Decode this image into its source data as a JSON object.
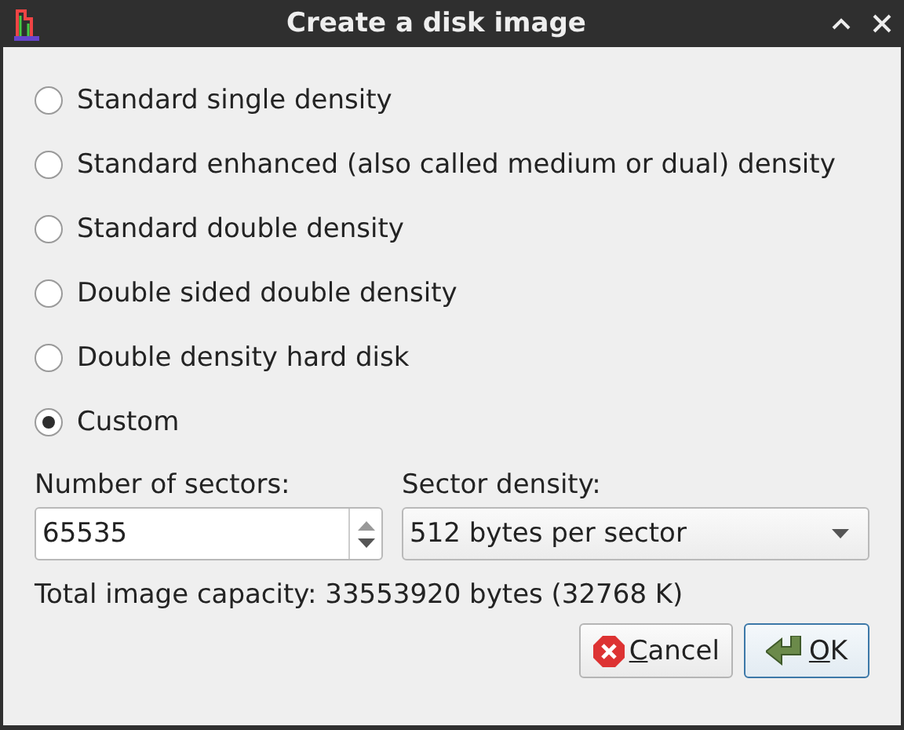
{
  "window": {
    "title": "Create a disk image"
  },
  "density_options": [
    {
      "label": "Standard single density",
      "selected": false
    },
    {
      "label": "Standard enhanced (also called medium or dual) density",
      "selected": false
    },
    {
      "label": "Standard double density",
      "selected": false
    },
    {
      "label": "Double sided double density",
      "selected": false
    },
    {
      "label": "Double density hard disk",
      "selected": false
    },
    {
      "label": "Custom",
      "selected": true
    }
  ],
  "sectors": {
    "label": "Number of sectors:",
    "value": "65535"
  },
  "sector_density": {
    "label": "Sector density:",
    "value": "512 bytes per sector"
  },
  "capacity": "Total image capacity: 33553920 bytes (32768 K)",
  "buttons": [
    {
      "kind": "cancel",
      "label": "Cancel"
    },
    {
      "kind": "ok",
      "label": "OK"
    }
  ]
}
